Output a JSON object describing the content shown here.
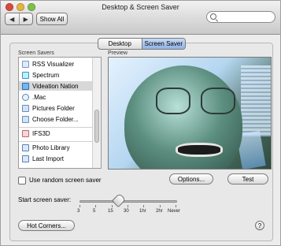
{
  "window": {
    "title": "Desktop & Screen Saver"
  },
  "toolbar": {
    "back_glyph": "◀",
    "forward_glyph": "▶",
    "show_all": "Show All",
    "search_placeholder": ""
  },
  "tabs": [
    {
      "label": "Desktop",
      "selected": false
    },
    {
      "label": "Screen Saver",
      "selected": true
    }
  ],
  "sections": {
    "screen_savers": "Screen Savers",
    "preview": "Preview"
  },
  "screen_savers": [
    {
      "label": "RSS Visualizer",
      "icon": "rss-icon"
    },
    {
      "label": "Spectrum",
      "icon": "spectrum-icon"
    },
    {
      "label": "Videation Nation",
      "icon": "videation-icon",
      "selected": true
    },
    {
      "label": ".Mac",
      "icon": "mac-icon"
    },
    {
      "label": "Pictures Folder",
      "icon": "folder-icon"
    },
    {
      "label": "Choose Folder...",
      "icon": "folder-icon"
    },
    {
      "label": "IFS3D",
      "icon": "ifs3d-icon",
      "separator_before": true
    },
    {
      "label": "Photo Library",
      "icon": "photo-library-icon",
      "separator_before": true
    },
    {
      "label": "Last Import",
      "icon": "last-import-icon"
    }
  ],
  "controls": {
    "random_checkbox_label": "Use random screen saver",
    "random_checked": false,
    "options_button": "Options...",
    "test_button": "Test",
    "start_label": "Start screen saver:",
    "start_ticks": [
      "3",
      "5",
      "15",
      "30",
      "1hr",
      "2hr",
      "Never"
    ],
    "start_selected": "15",
    "hot_corners_button": "Hot Corners...",
    "help_glyph": "?"
  },
  "colors": {
    "tab_selected": "#8eb3e7",
    "list_selected": "#d8d8d8",
    "window_bg": "#ececec"
  }
}
